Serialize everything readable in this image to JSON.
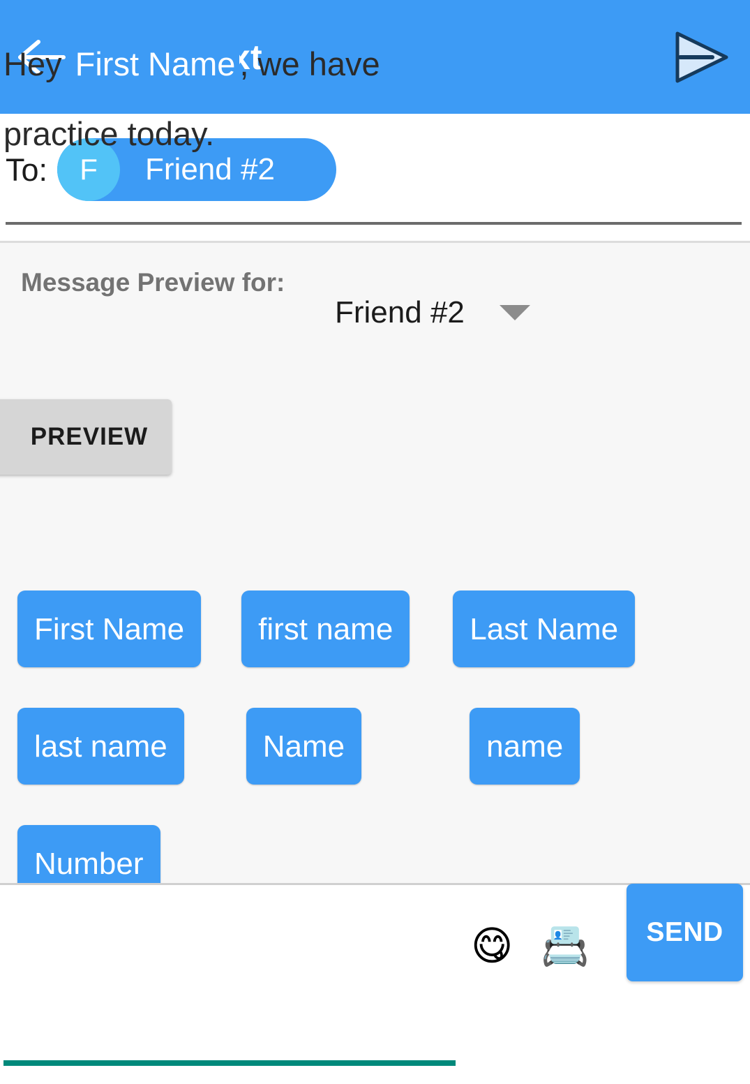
{
  "header": {
    "title": "Send Text",
    "back_icon": "arrow-left-icon",
    "send_icon": "paper-plane-icon",
    "background_color": "#3d9bf5"
  },
  "recipient": {
    "label": "To:",
    "chip": {
      "avatar_initial": "F",
      "name": "Friend #2",
      "chip_color": "#3d9bf5",
      "avatar_color": "#52c3f7"
    }
  },
  "preview_panel": {
    "label": "Message Preview for:",
    "dropdown": {
      "value": "Friend #2",
      "caret_icon": "chevron-down-icon"
    },
    "preview_button": "PREVIEW",
    "tokens": [
      [
        "First Name",
        "first name",
        "Last Name"
      ],
      [
        "last name",
        "Name",
        "name"
      ],
      [
        "Number"
      ]
    ]
  },
  "composer": {
    "message_before": "Hey ",
    "message_token": "First Name",
    "message_after": ", we have practice today.",
    "emoji_icon": "😋",
    "contact_icon": "📇",
    "send_label": "SEND",
    "underline_color": "#00897b"
  }
}
